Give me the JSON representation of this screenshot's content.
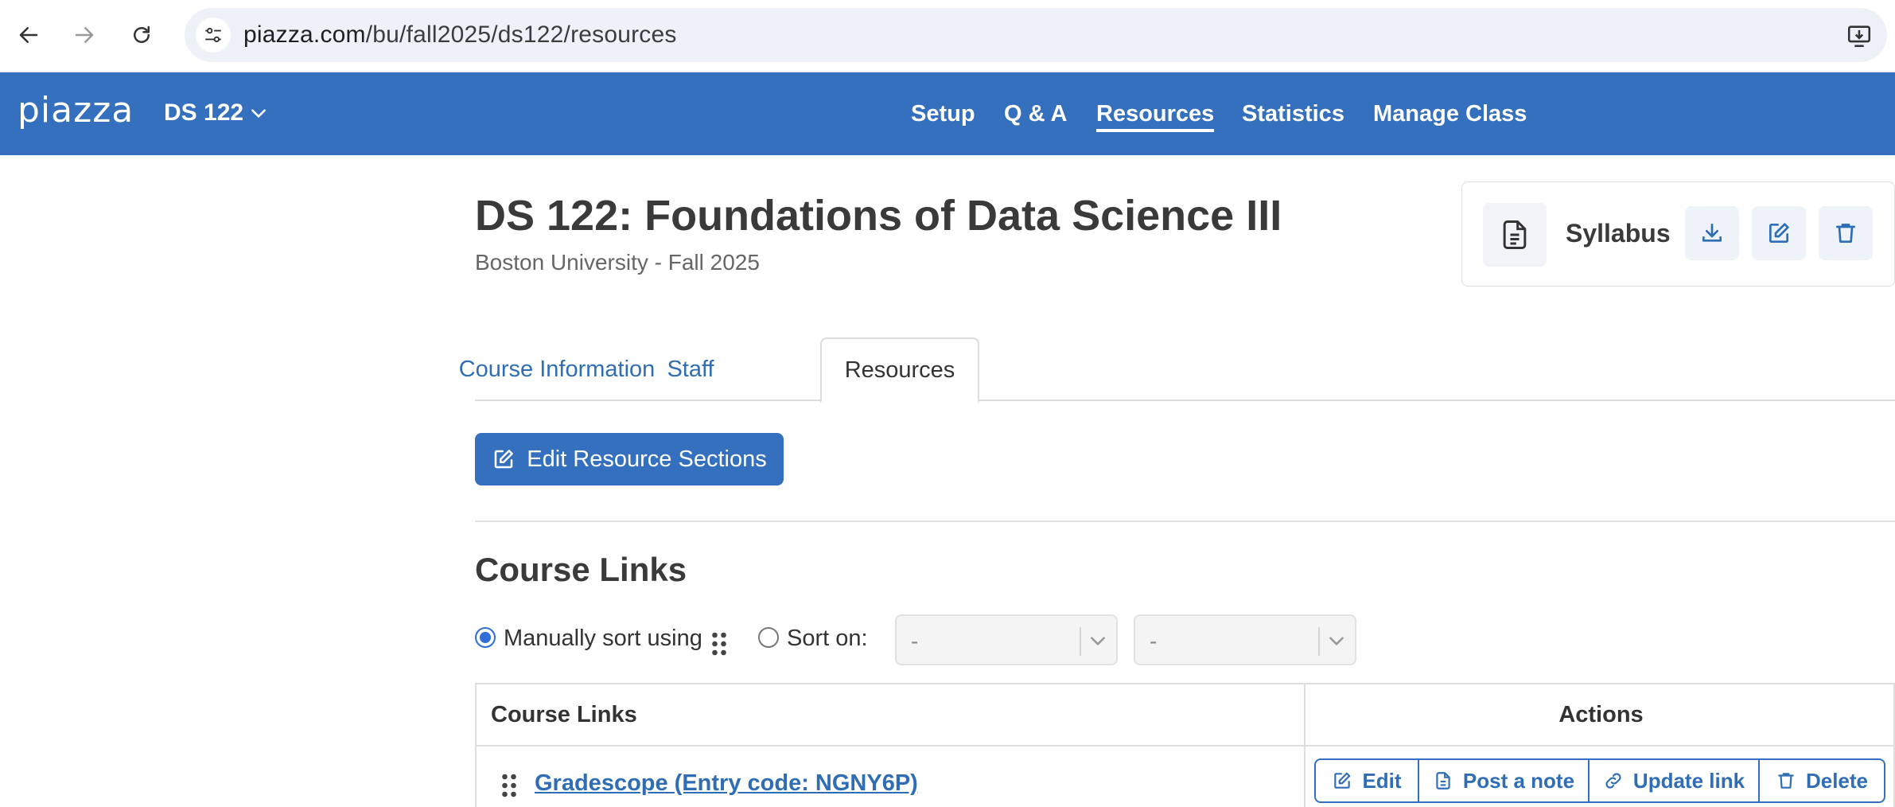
{
  "browser": {
    "url_domain": "piazza.com",
    "url_path": "/bu/fall2025/ds122/resources"
  },
  "header": {
    "logo": "piazza",
    "class_name": "DS 122",
    "nav": [
      {
        "label": "Setup",
        "active": false
      },
      {
        "label": "Q & A",
        "active": false
      },
      {
        "label": "Resources",
        "active": true
      },
      {
        "label": "Statistics",
        "active": false
      },
      {
        "label": "Manage Class",
        "active": false
      }
    ],
    "bg_color": "#3570be"
  },
  "course": {
    "title": "DS 122: Foundations of Data Science III",
    "subtitle": "Boston University - Fall 2025"
  },
  "syllabus": {
    "label": "Syllabus",
    "icons": [
      "download-icon",
      "edit-icon",
      "trash-icon"
    ]
  },
  "tabs": [
    {
      "label": "Course Information",
      "active": false
    },
    {
      "label": "Staff",
      "active": false
    },
    {
      "label": "Resources",
      "active": true
    }
  ],
  "edit_sections_label": "Edit Resource Sections",
  "course_links": {
    "title": "Course Links",
    "sort": {
      "manual_label": "Manually sort using",
      "sort_on_label": "Sort on:",
      "select1_value": "-",
      "select2_value": "-",
      "selected": "manual"
    },
    "table": {
      "col_links": "Course Links",
      "col_actions": "Actions",
      "rows": [
        {
          "link": "Gradescope (Entry code: NGNY6P)"
        }
      ],
      "actions": [
        "Edit",
        "Post a note",
        "Update link",
        "Delete"
      ]
    }
  }
}
